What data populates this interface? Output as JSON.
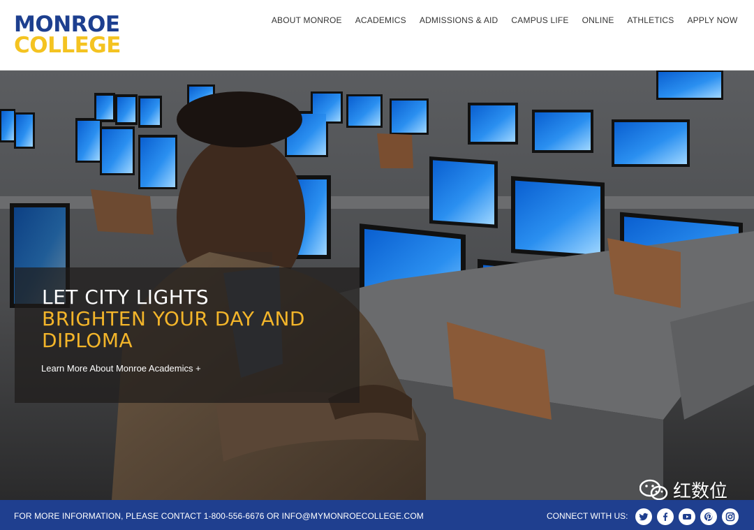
{
  "brand": {
    "line1": "MONROE",
    "line2": "COLLEGE",
    "primary_color": "#1d3f8f",
    "accent_color": "#f4c321"
  },
  "nav": {
    "items": [
      {
        "label": "ABOUT MONROE"
      },
      {
        "label": "ACADEMICS"
      },
      {
        "label": "ADMISSIONS & AID"
      },
      {
        "label": "CAMPUS LIFE"
      },
      {
        "label": "ONLINE"
      },
      {
        "label": "ATHLETICS"
      },
      {
        "label": "APPLY NOW"
      }
    ]
  },
  "hero": {
    "headline_white": "LET CITY LIGHTS",
    "headline_gold": "BRIGHTEN YOUR DAY AND DIPLOMA",
    "link_text": "Learn More About Monroe Academics +",
    "gold_color": "#f3b52a"
  },
  "footer": {
    "info": "FOR MORE INFORMATION, PLEASE CONTACT 1-800-556-6676 OR INFO@MYMONROECOLLEGE.COM",
    "connect_label": "CONNECT WITH US:",
    "socials": [
      "twitter-icon",
      "facebook-icon",
      "youtube-icon",
      "pinterest-icon",
      "instagram-icon"
    ],
    "bg_color": "#1f3f8f"
  },
  "watermark": {
    "text": "红数位",
    "icon": "wechat-icon"
  }
}
